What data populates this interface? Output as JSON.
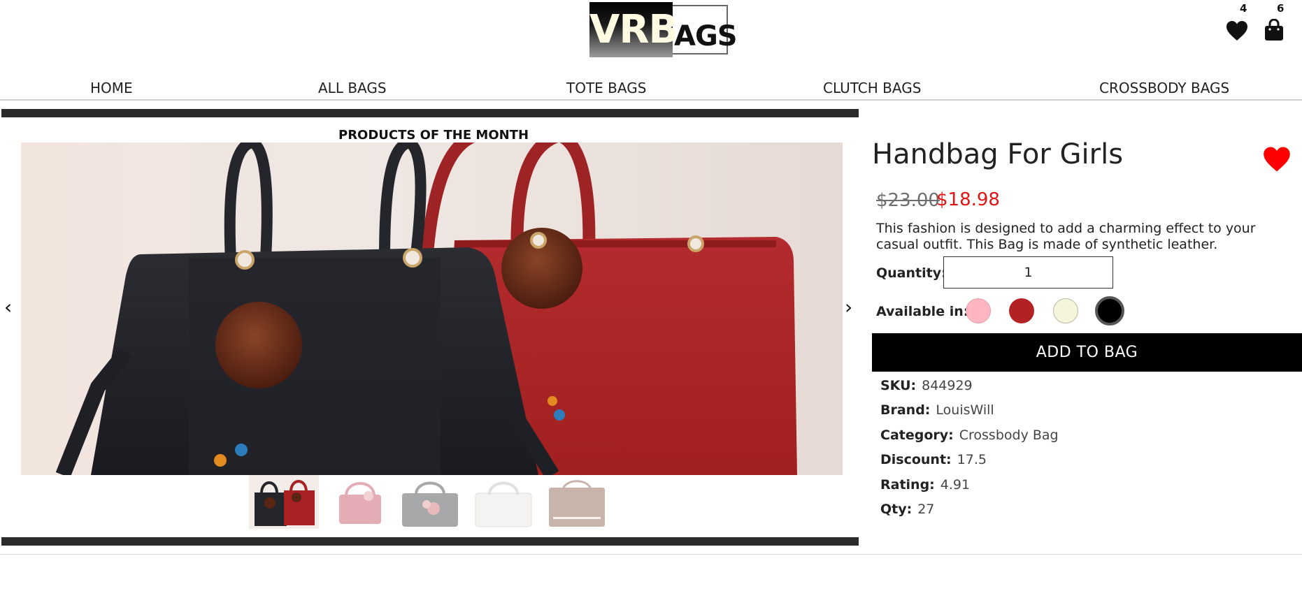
{
  "brand": {
    "logo_dark": "VRB",
    "logo_light": "AGS"
  },
  "header": {
    "wishlist_count": "4",
    "bag_count": "6",
    "wishlist_icon": "heart-icon",
    "bag_icon": "shopping-bag-icon"
  },
  "nav": {
    "items": [
      {
        "label": "HOME"
      },
      {
        "label": "ALL BAGS"
      },
      {
        "label": "TOTE BAGS"
      },
      {
        "label": "CLUTCH BAGS"
      },
      {
        "label": "CROSSBODY BAGS"
      }
    ]
  },
  "carousel": {
    "title": "PRODUCTS OF THE MONTH",
    "prev": "‹",
    "next": "›",
    "thumbnails": [
      {
        "alt": "black and red handbags",
        "active": true
      },
      {
        "alt": "pink handbag",
        "active": false
      },
      {
        "alt": "grey embroidered handbag",
        "active": false
      },
      {
        "alt": "white handbag",
        "active": false
      },
      {
        "alt": "beige clutch",
        "active": false
      }
    ]
  },
  "product": {
    "title": "Handbag For Girls",
    "old_price": "$23.00",
    "price": "$18.98",
    "description": "This fashion is designed to add a charming effect to your casual outfit. This Bag is made of synthetic leather.",
    "quantity_label": "Quantity:",
    "quantity_value": "1",
    "available_label": "Available in:",
    "colors": [
      "#ffb6c1",
      "#b22222",
      "#f5f5dc",
      "#000000"
    ],
    "selected_color": "#000000",
    "add_to_bag": "ADD TO BAG",
    "favorite_icon": "heart-icon",
    "accent_color": "#ff0000",
    "specs": [
      {
        "key": "SKU:",
        "value": "844929"
      },
      {
        "key": "Brand:",
        "value": "LouisWill"
      },
      {
        "key": "Category:",
        "value": "Crossbody Bag"
      },
      {
        "key": "Discount:",
        "value": "17.5"
      },
      {
        "key": "Rating:",
        "value": "4.91"
      },
      {
        "key": "Qty:",
        "value": "27"
      }
    ]
  }
}
